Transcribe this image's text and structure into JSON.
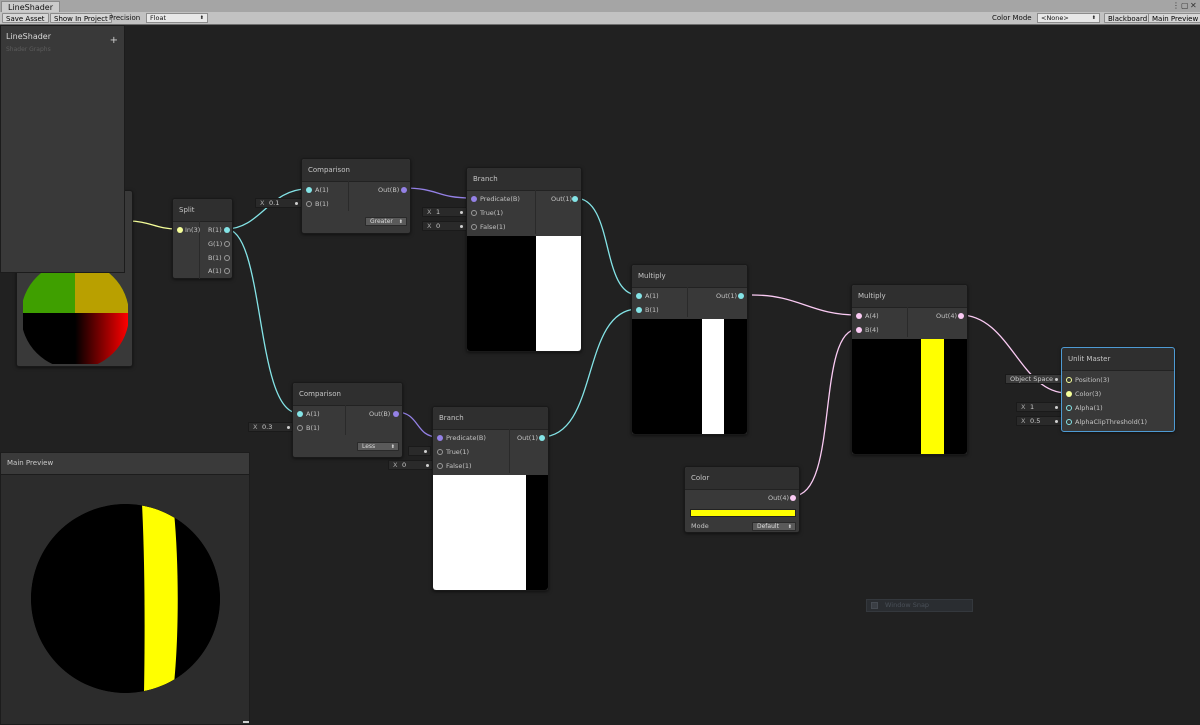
{
  "window": {
    "tab_title": "LineShader"
  },
  "toolbar": {
    "save_asset": "Save Asset",
    "show_in_project": "Show In Project",
    "precision_label": "Precision",
    "precision_value": "Float",
    "color_mode_label": "Color Mode",
    "color_mode_value": "<None>",
    "blackboard": "Blackboard",
    "main_preview": "Main Preview"
  },
  "blackboard": {
    "title": "LineShader",
    "subtitle": "Shader Graphs"
  },
  "nodes": {
    "split": {
      "title": "Split",
      "input": "In(3)",
      "outputs": [
        "R(1)",
        "G(1)",
        "B(1)",
        "A(1)"
      ]
    },
    "comparison_top": {
      "title": "Comparison",
      "in_a": "A(1)",
      "in_b": "B(1)",
      "out": "Out(B)",
      "mode": "Greater",
      "b_axis": "X",
      "b_value": "0.1"
    },
    "comparison_bottom": {
      "title": "Comparison",
      "in_a": "A(1)",
      "in_b": "B(1)",
      "out": "Out(B)",
      "mode": "Less",
      "b_axis": "X",
      "b_value": "0.3"
    },
    "branch_top": {
      "title": "Branch",
      "pred": "Predicate(B)",
      "true": "True(1)",
      "false": "False(1)",
      "out": "Out(1)",
      "true_axis": "X",
      "true_value": "1",
      "false_axis": "X",
      "false_value": "0"
    },
    "branch_bottom": {
      "title": "Branch",
      "pred": "Predicate(B)",
      "true": "True(1)",
      "false": "False(1)",
      "out": "Out(1)",
      "false_axis": "X",
      "false_value": "0"
    },
    "multiply_1": {
      "title": "Multiply",
      "in_a": "A(1)",
      "in_b": "B(1)",
      "out": "Out(1)"
    },
    "multiply_2": {
      "title": "Multiply",
      "in_a": "A(4)",
      "in_b": "B(4)",
      "out": "Out(4)"
    },
    "color": {
      "title": "Color",
      "out": "Out(4)",
      "mode_label": "Mode",
      "mode_value": "Default",
      "swatch": "#ffff00"
    },
    "unlit_master": {
      "title": "Unlit Master",
      "inputs": [
        "Position(3)",
        "Color(3)",
        "Alpha(1)",
        "AlphaClipThreshold(1)"
      ],
      "position_space": "Object Space",
      "alpha_axis": "X",
      "alpha_value": "1",
      "clip_axis": "X",
      "clip_value": "0.5"
    }
  },
  "main_preview": {
    "title": "Main Preview"
  },
  "window_snap": {
    "label": "Window Snap"
  },
  "colors": {
    "canvas": "#212121",
    "node": "#393939",
    "wire_float": "#84e4e7",
    "wire_bool": "#9481e6",
    "wire_vec3": "#f6ff9a",
    "wire_vec4": "#fbcbf4",
    "accent_yellow": "#ffff00",
    "master_outline": "#4e9bd4"
  }
}
